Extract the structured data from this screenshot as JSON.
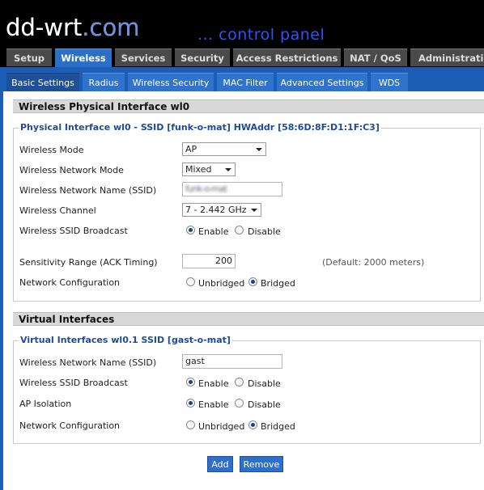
{
  "header": {
    "logo_main": "dd-wrt",
    "logo_suffix": ".com",
    "subtitle": "... control panel"
  },
  "top_tabs": [
    "Setup",
    "Wireless",
    "Services",
    "Security",
    "Access Restrictions",
    "NAT / QoS",
    "Administration"
  ],
  "active_top_tab": "Wireless",
  "sub_tabs": [
    "Basic Settings",
    "Radius",
    "Wireless Security",
    "MAC Filter",
    "Advanced Settings",
    "WDS"
  ],
  "active_sub_tab": "Basic Settings",
  "physical": {
    "section_title": "Wireless Physical Interface wl0",
    "legend": "Physical Interface wl0 - SSID [funk-o-mat] HWAddr [58:6D:8F:D1:1F:C3]",
    "wireless_mode_label": "Wireless Mode",
    "wireless_mode_value": "AP",
    "network_mode_label": "Wireless Network Mode",
    "network_mode_value": "Mixed",
    "ssid_label": "Wireless Network Name (SSID)",
    "ssid_value": "funk-o-mat",
    "channel_label": "Wireless Channel",
    "channel_value": "7 - 2.442 GHz",
    "broadcast_label": "Wireless SSID Broadcast",
    "broadcast_enable": "Enable",
    "broadcast_disable": "Disable",
    "broadcast_selected": "Enable",
    "sensitivity_label": "Sensitivity Range (ACK Timing)",
    "sensitivity_value": "200",
    "sensitivity_default": "(Default: 2000 meters)",
    "netconf_label": "Network Configuration",
    "netconf_unbridged": "Unbridged",
    "netconf_bridged": "Bridged",
    "netconf_selected": "Bridged"
  },
  "virtual": {
    "section_title": "Virtual Interfaces",
    "legend": "Virtual Interfaces wl0.1 SSID [gast-o-mat]",
    "ssid_label": "Wireless Network Name (SSID)",
    "ssid_value": "gast",
    "broadcast_label": "Wireless SSID Broadcast",
    "broadcast_enable": "Enable",
    "broadcast_disable": "Disable",
    "broadcast_selected": "Enable",
    "isolation_label": "AP Isolation",
    "isolation_enable": "Enable",
    "isolation_disable": "Disable",
    "isolation_selected": "Enable",
    "netconf_label": "Network Configuration",
    "netconf_unbridged": "Unbridged",
    "netconf_bridged": "Bridged",
    "netconf_selected": "Bridged"
  },
  "buttons": {
    "add": "Add",
    "remove": "Remove"
  },
  "colors": {
    "header_bg": "#000000",
    "active_tab": "#2b6fc8",
    "tab_inactive": "#4a4a4a",
    "subbar": "#1c5db5",
    "legend_text": "#1f4a9a"
  }
}
